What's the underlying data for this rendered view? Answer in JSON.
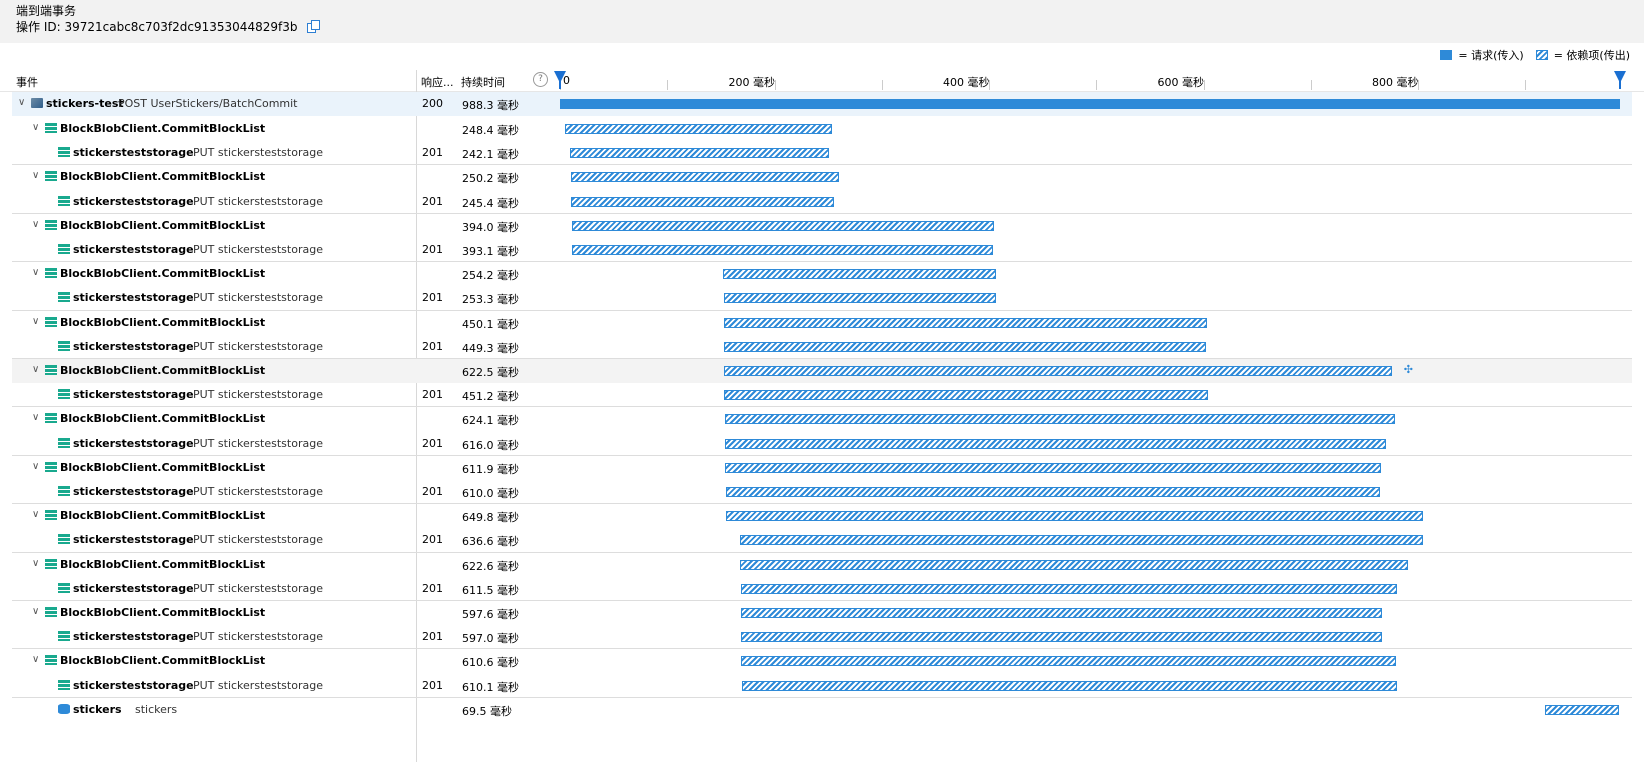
{
  "header": {
    "title": "端到端事务",
    "operation_id": "操作 ID: 39721cabc8c703f2dc91353044829f3b"
  },
  "legend": {
    "request": "= 请求(传入)",
    "dependency": "= 依赖项(传出)"
  },
  "columns": {
    "event": "事件",
    "response": "响应...",
    "duration": "持续时间",
    "help": "?"
  },
  "timeline": {
    "ticks": [
      "0",
      "200 毫秒",
      "400 毫秒",
      "600 毫秒",
      "800 毫秒"
    ],
    "total_ms": 988.3
  },
  "colors": {
    "accent": "#2e8ad8",
    "marker": "#1a6fd1"
  },
  "rows": [
    {
      "kind": "request",
      "icon": "app-icon",
      "name": "stickers-test",
      "detail": "POST UserStickers/BatchCommit",
      "code": "200",
      "duration": "988.3 毫秒",
      "start": 0,
      "ms": 988.3,
      "expand": true
    },
    {
      "kind": "dep",
      "icon": "dependency-icon",
      "name": "BlockBlobClient.CommitBlockList",
      "detail": "",
      "code": "",
      "duration": "248.4 毫秒",
      "start": 5,
      "ms": 248.4,
      "expand": true
    },
    {
      "kind": "dep",
      "icon": "dependency-icon",
      "name": "stickersteststorage",
      "detail": "PUT stickersteststorage",
      "code": "201",
      "duration": "242.1 毫秒",
      "start": 9,
      "ms": 242.1
    },
    {
      "kind": "dep",
      "icon": "dependency-icon",
      "name": "BlockBlobClient.CommitBlockList",
      "detail": "",
      "code": "",
      "duration": "250.2 毫秒",
      "start": 10,
      "ms": 250.2,
      "expand": true
    },
    {
      "kind": "dep",
      "icon": "dependency-icon",
      "name": "stickersteststorage",
      "detail": "PUT stickersteststorage",
      "code": "201",
      "duration": "245.4 毫秒",
      "start": 10,
      "ms": 245.4
    },
    {
      "kind": "dep",
      "icon": "dependency-icon",
      "name": "BlockBlobClient.CommitBlockList",
      "detail": "",
      "code": "",
      "duration": "394.0 毫秒",
      "start": 11,
      "ms": 394.0,
      "expand": true
    },
    {
      "kind": "dep",
      "icon": "dependency-icon",
      "name": "stickersteststorage",
      "detail": "PUT stickersteststorage",
      "code": "201",
      "duration": "393.1 毫秒",
      "start": 11,
      "ms": 393.1
    },
    {
      "kind": "dep",
      "icon": "dependency-icon",
      "name": "BlockBlobClient.CommitBlockList",
      "detail": "",
      "code": "",
      "duration": "254.2 毫秒",
      "start": 152,
      "ms": 254.2,
      "expand": true
    },
    {
      "kind": "dep",
      "icon": "dependency-icon",
      "name": "stickersteststorage",
      "detail": "PUT stickersteststorage",
      "code": "201",
      "duration": "253.3 毫秒",
      "start": 153,
      "ms": 253.3
    },
    {
      "kind": "dep",
      "icon": "dependency-icon",
      "name": "BlockBlobClient.CommitBlockList",
      "detail": "",
      "code": "",
      "duration": "450.1 毫秒",
      "start": 153,
      "ms": 450.1,
      "expand": true
    },
    {
      "kind": "dep",
      "icon": "dependency-icon",
      "name": "stickersteststorage",
      "detail": "PUT stickersteststorage",
      "code": "201",
      "duration": "449.3 毫秒",
      "start": 153,
      "ms": 449.3
    },
    {
      "kind": "dep",
      "icon": "dependency-icon",
      "name": "BlockBlobClient.CommitBlockList",
      "detail": "",
      "code": "",
      "duration": "622.5 毫秒",
      "start": 153,
      "ms": 622.5,
      "expand": true,
      "highlight": true,
      "collapse_icon": true
    },
    {
      "kind": "dep",
      "icon": "dependency-icon",
      "name": "stickersteststorage",
      "detail": "PUT stickersteststorage",
      "code": "201",
      "duration": "451.2 毫秒",
      "start": 153,
      "ms": 451.2
    },
    {
      "kind": "dep",
      "icon": "dependency-icon",
      "name": "BlockBlobClient.CommitBlockList",
      "detail": "",
      "code": "",
      "duration": "624.1 毫秒",
      "start": 154,
      "ms": 624.1,
      "expand": true
    },
    {
      "kind": "dep",
      "icon": "dependency-icon",
      "name": "stickersteststorage",
      "detail": "PUT stickersteststorage",
      "code": "201",
      "duration": "616.0 毫秒",
      "start": 154,
      "ms": 616.0
    },
    {
      "kind": "dep",
      "icon": "dependency-icon",
      "name": "BlockBlobClient.CommitBlockList",
      "detail": "",
      "code": "",
      "duration": "611.9 毫秒",
      "start": 154,
      "ms": 611.9,
      "expand": true
    },
    {
      "kind": "dep",
      "icon": "dependency-icon",
      "name": "stickersteststorage",
      "detail": "PUT stickersteststorage",
      "code": "201",
      "duration": "610.0 毫秒",
      "start": 155,
      "ms": 610.0
    },
    {
      "kind": "dep",
      "icon": "dependency-icon",
      "name": "BlockBlobClient.CommitBlockList",
      "detail": "",
      "code": "",
      "duration": "649.8 毫秒",
      "start": 155,
      "ms": 649.8,
      "expand": true
    },
    {
      "kind": "dep",
      "icon": "dependency-icon",
      "name": "stickersteststorage",
      "detail": "PUT stickersteststorage",
      "code": "201",
      "duration": "636.6 毫秒",
      "start": 168,
      "ms": 636.6
    },
    {
      "kind": "dep",
      "icon": "dependency-icon",
      "name": "BlockBlobClient.CommitBlockList",
      "detail": "",
      "code": "",
      "duration": "622.6 毫秒",
      "start": 168,
      "ms": 622.6,
      "expand": true
    },
    {
      "kind": "dep",
      "icon": "dependency-icon",
      "name": "stickersteststorage",
      "detail": "PUT stickersteststorage",
      "code": "201",
      "duration": "611.5 毫秒",
      "start": 169,
      "ms": 611.5
    },
    {
      "kind": "dep",
      "icon": "dependency-icon",
      "name": "BlockBlobClient.CommitBlockList",
      "detail": "",
      "code": "",
      "duration": "597.6 毫秒",
      "start": 169,
      "ms": 597.6,
      "expand": true
    },
    {
      "kind": "dep",
      "icon": "dependency-icon",
      "name": "stickersteststorage",
      "detail": "PUT stickersteststorage",
      "code": "201",
      "duration": "597.0 毫秒",
      "start": 169,
      "ms": 597.0
    },
    {
      "kind": "dep",
      "icon": "dependency-icon",
      "name": "BlockBlobClient.CommitBlockList",
      "detail": "",
      "code": "",
      "duration": "610.6 毫秒",
      "start": 169,
      "ms": 610.6,
      "expand": true
    },
    {
      "kind": "dep",
      "icon": "dependency-icon",
      "name": "stickersteststorage",
      "detail": "PUT stickersteststorage",
      "code": "201",
      "duration": "610.1 毫秒",
      "start": 170,
      "ms": 610.1
    },
    {
      "kind": "dep",
      "icon": "sql-icon",
      "name": "stickers",
      "detail": "stickers",
      "code": "",
      "duration": "69.5 毫秒",
      "start": 918,
      "ms": 69.5
    }
  ]
}
